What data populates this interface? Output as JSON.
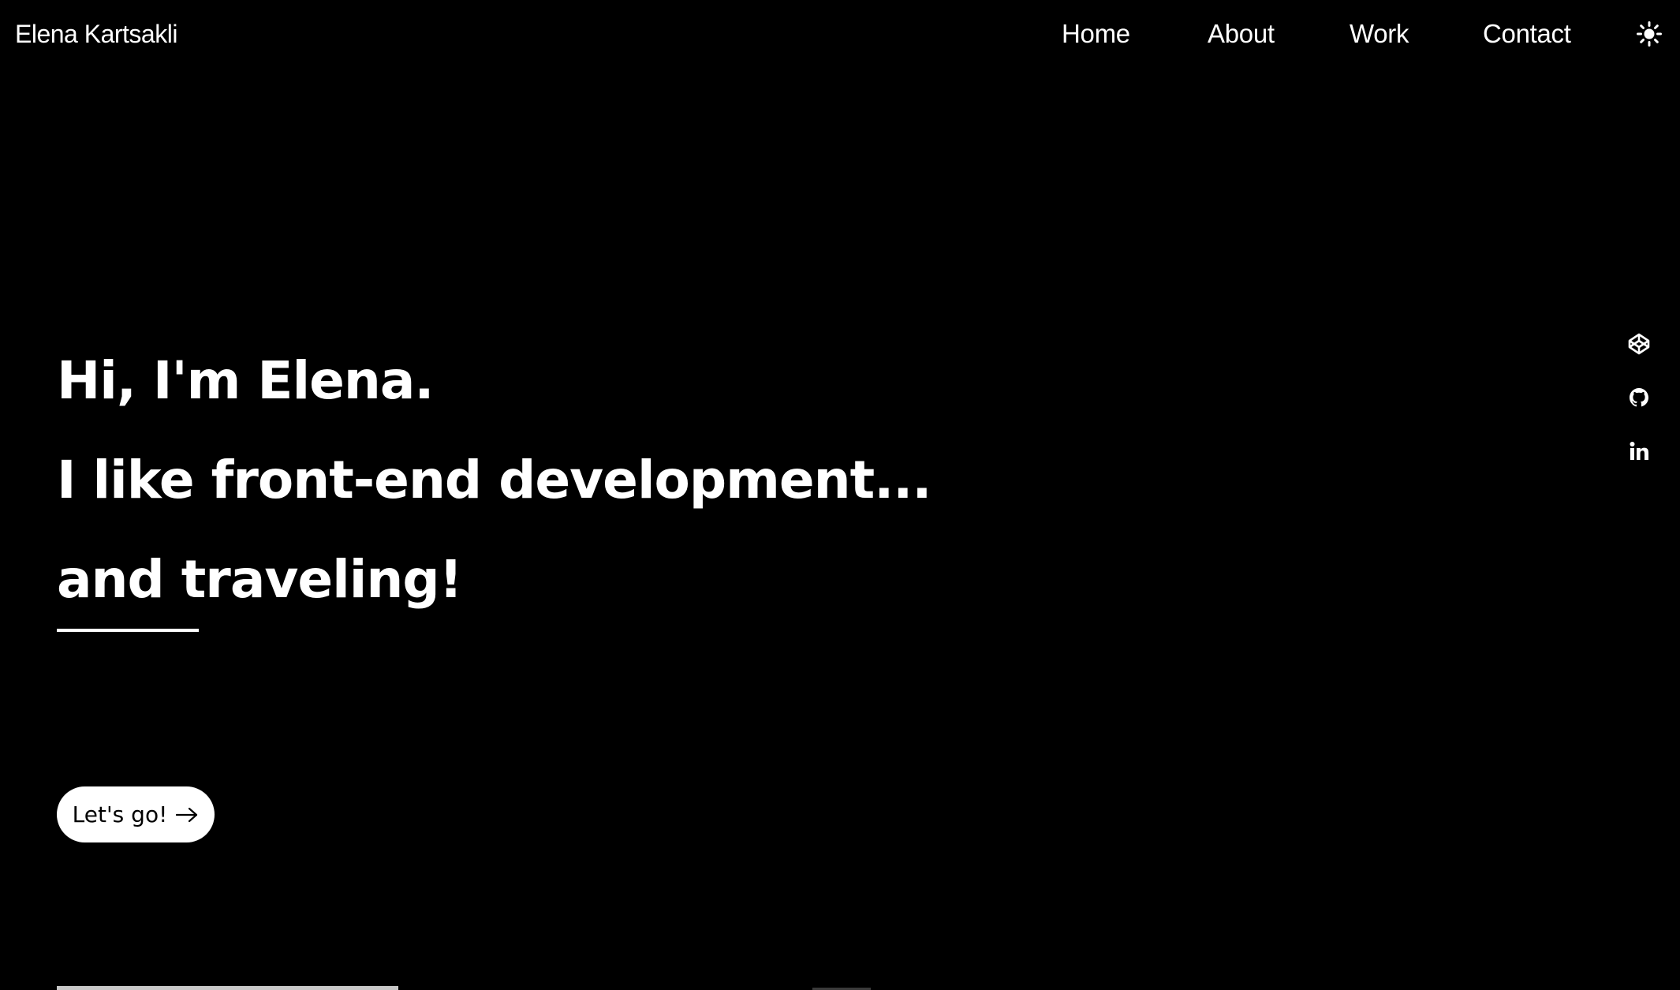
{
  "header": {
    "brand": "Elena Kartsakli",
    "nav": {
      "home": "Home",
      "about": "About",
      "work": "Work",
      "contact": "Contact"
    },
    "theme_toggle_icon": "sun-icon"
  },
  "hero": {
    "line1": "Hi, I'm Elena.",
    "line2": "I like front-end development...",
    "line3": "and traveling!",
    "cta_label": "Let's go!",
    "cta_icon": "arrow-right-icon"
  },
  "social": {
    "icons": [
      "codepen-icon",
      "github-icon",
      "linkedin-icon"
    ]
  },
  "colors": {
    "background": "#000000",
    "text": "#ffffff",
    "button_bg": "#ffffff",
    "button_text": "#000000"
  }
}
